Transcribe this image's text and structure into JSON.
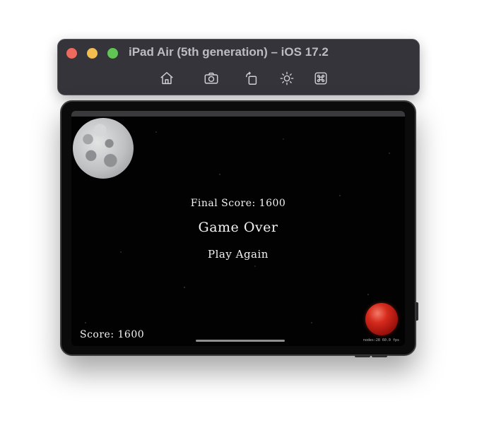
{
  "window": {
    "title": "iPad Air (5th generation) – iOS 17.2",
    "toolbar_buttons": [
      {
        "name": "home",
        "icon": "home-icon"
      },
      {
        "name": "screenshot",
        "icon": "camera-icon"
      },
      {
        "name": "rotate",
        "icon": "rotate-icon"
      },
      {
        "name": "appearance",
        "icon": "brightness-icon"
      },
      {
        "name": "shortcuts",
        "icon": "command-icon"
      }
    ]
  },
  "game": {
    "final_score": "Final Score: 1600",
    "game_over": "Game Over",
    "play_again": "Play Again",
    "score": "Score: 1600",
    "stats": "nodes:28  60.0 fps"
  },
  "colors": {
    "toolbar_bg": "#35343a",
    "close": "#ed6a5e",
    "minimize": "#f4be4f",
    "maximize": "#61c554",
    "game_bg": "#020202",
    "text": "#f3f3f3",
    "mars": "#d62a1c"
  }
}
